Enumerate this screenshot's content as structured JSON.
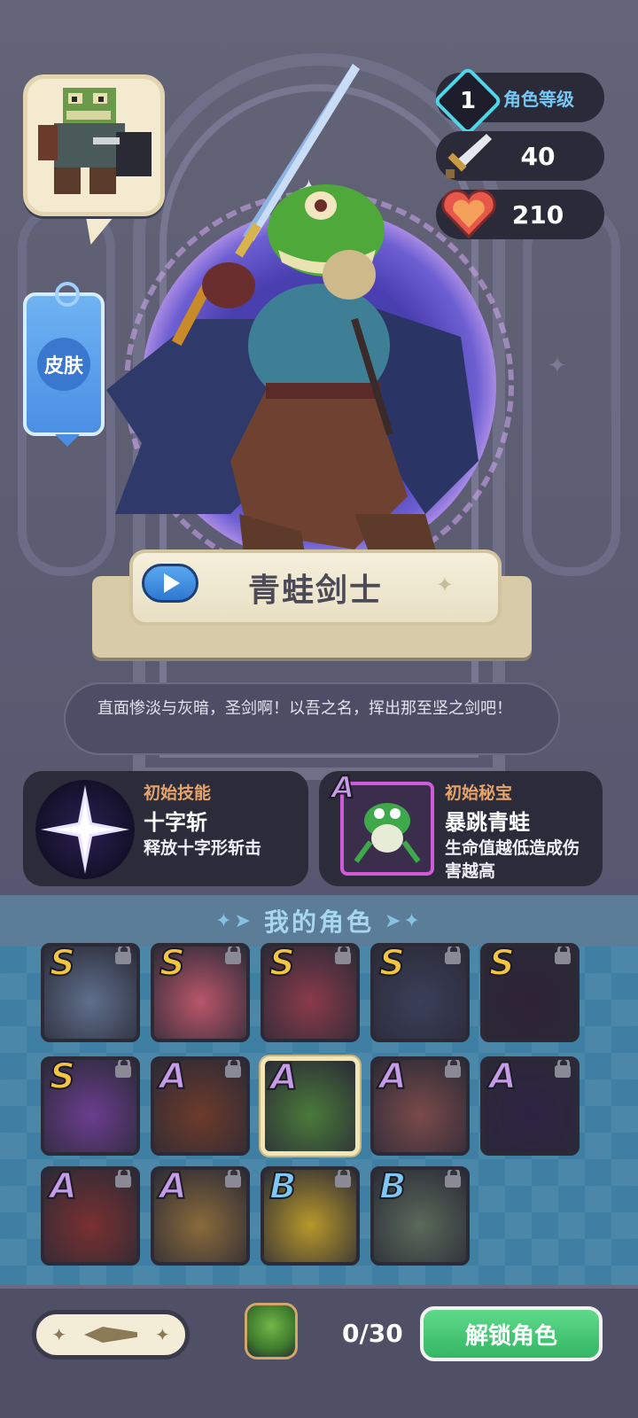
{
  "stats": {
    "level": "1",
    "level_label": "角色等级",
    "attack": "40",
    "health": "210"
  },
  "skin_button": {
    "label": "皮肤"
  },
  "character": {
    "name": "青蛙剑士",
    "quote": "直面惨淡与灰暗，圣剑啊！以吾之名，挥出那至坚之剑吧！"
  },
  "skill": {
    "label": "初始技能",
    "name": "十字斩",
    "description": "释放十字形斩击"
  },
  "relic": {
    "label": "初始秘宝",
    "rank": "A",
    "name": "暴跳青蛙",
    "description": "生命值越低造成伤害越高"
  },
  "roster": {
    "title": "我的角色",
    "rows": [
      [
        {
          "rank": "S",
          "locked": true,
          "color": "#5f6f8c"
        },
        {
          "rank": "S",
          "locked": true,
          "color": "#b9566a"
        },
        {
          "rank": "S",
          "locked": true,
          "color": "#8a3a4a"
        },
        {
          "rank": "S",
          "locked": true,
          "color": "#3a3f5a"
        },
        {
          "rank": "S",
          "locked": true,
          "color": "#2e2236"
        }
      ],
      [
        {
          "rank": "S",
          "locked": true,
          "color": "#6a3d8f"
        },
        {
          "rank": "A",
          "locked": true,
          "color": "#6e3a2a"
        },
        {
          "rank": "A",
          "locked": false,
          "selected": true,
          "color": "#4a7a3a"
        },
        {
          "rank": "A",
          "locked": true,
          "color": "#7a4a4a"
        },
        {
          "rank": "A",
          "locked": true,
          "color": "#2e2244"
        }
      ],
      [
        {
          "rank": "A",
          "locked": true,
          "color": "#7a3030"
        },
        {
          "rank": "A",
          "locked": true,
          "color": "#8a6a3a"
        },
        {
          "rank": "B",
          "locked": true,
          "color": "#b8982a"
        },
        {
          "rank": "B",
          "locked": true,
          "color": "#5a6a5a"
        }
      ]
    ]
  },
  "footer": {
    "counter": "0/30",
    "unlock_label": "解锁角色"
  },
  "colors": {
    "accent_green": "#34b765",
    "level_cyan": "#4fd6e8",
    "skin_blue": "#4a8fe4",
    "orange_label": "#e6a46a"
  }
}
